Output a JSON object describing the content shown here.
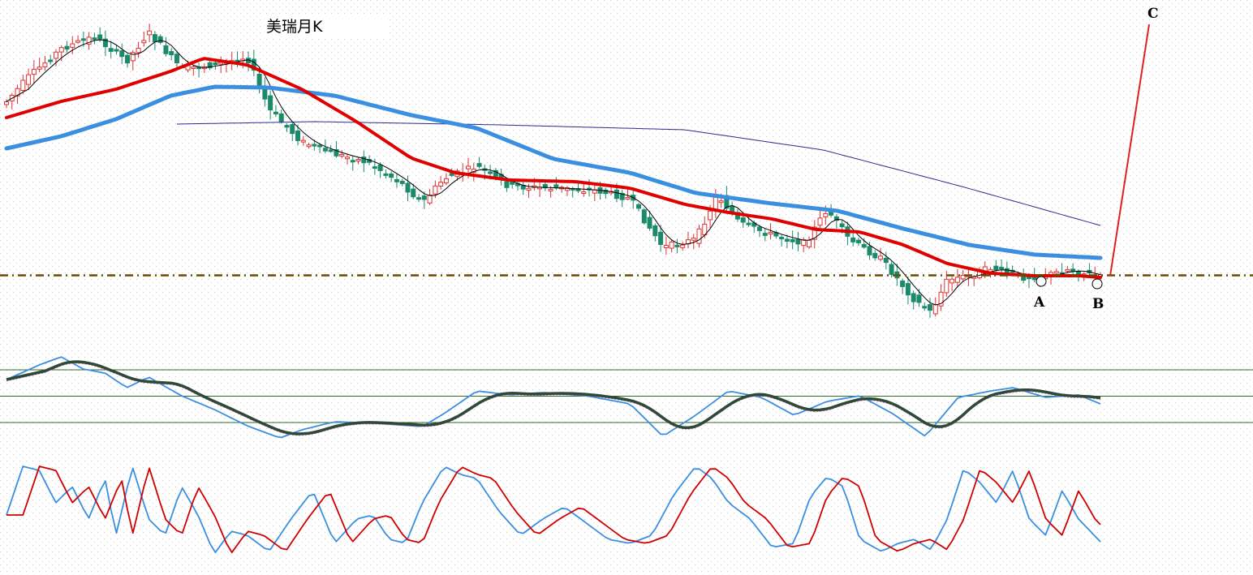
{
  "title": "美瑞月K",
  "chart_data": [
    {
      "type": "candlestick",
      "title": "美瑞月K",
      "series": [],
      "x_count": 200,
      "candles": [],
      "ma_lines": [
        {
          "key": "ma_short_black",
          "color": "#000000"
        },
        {
          "key": "ma_mid_red",
          "color": "#e00000"
        },
        {
          "key": "ma_long_blue",
          "color": "#3a8fe0"
        },
        {
          "key": "ma_longer_navy",
          "color": "#2a2a90"
        }
      ],
      "levels": [
        {
          "name": "",
          "style": "dash-dot",
          "color": "#6b4a00"
        }
      ],
      "annotations": [
        {
          "text": "A"
        },
        {
          "text": "B"
        },
        {
          "text": "C"
        }
      ],
      "colors": {
        "up": "#e03030",
        "down": "#1a8a6a"
      },
      "grid": true
    },
    {
      "type": "line",
      "title": "",
      "series": [
        {
          "color": "#3a8fe0"
        },
        {
          "color": "#2e4a36"
        }
      ],
      "grid": true,
      "reference_lines": 3
    },
    {
      "type": "line",
      "title": "",
      "series": [
        {
          "color": "#3a8fe0"
        },
        {
          "color": "#d00000"
        }
      ],
      "grid": true
    }
  ]
}
